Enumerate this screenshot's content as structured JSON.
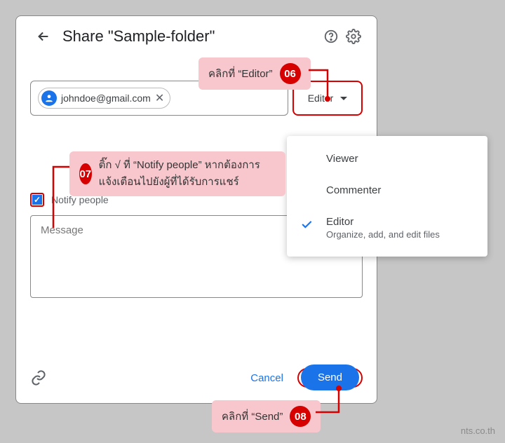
{
  "header": {
    "title": "Share \"Sample-folder\""
  },
  "people": {
    "chip_email": "johndoe@gmail.com",
    "role_button_label": "Editor"
  },
  "notify": {
    "label": "Notify people",
    "checked": true
  },
  "message": {
    "placeholder": "Message"
  },
  "footer": {
    "cancel": "Cancel",
    "send": "Send"
  },
  "role_menu": {
    "items": [
      {
        "label": "Viewer",
        "selected": false
      },
      {
        "label": "Commenter",
        "selected": false
      },
      {
        "label": "Editor",
        "sub": "Organize, add, and edit files",
        "selected": true
      }
    ]
  },
  "annotations": {
    "a06": {
      "num": "06",
      "text": "คลิกที่ “Editor”"
    },
    "a07": {
      "num": "07",
      "text": "ติ๊ก √ ที่ “Notify people” หากต้องการแจ้งเตือนไปยังผู้ที่ได้รับการแชร์"
    },
    "a08": {
      "num": "08",
      "text": "คลิกที่ “Send”"
    }
  },
  "watermark": "nts.co.th"
}
